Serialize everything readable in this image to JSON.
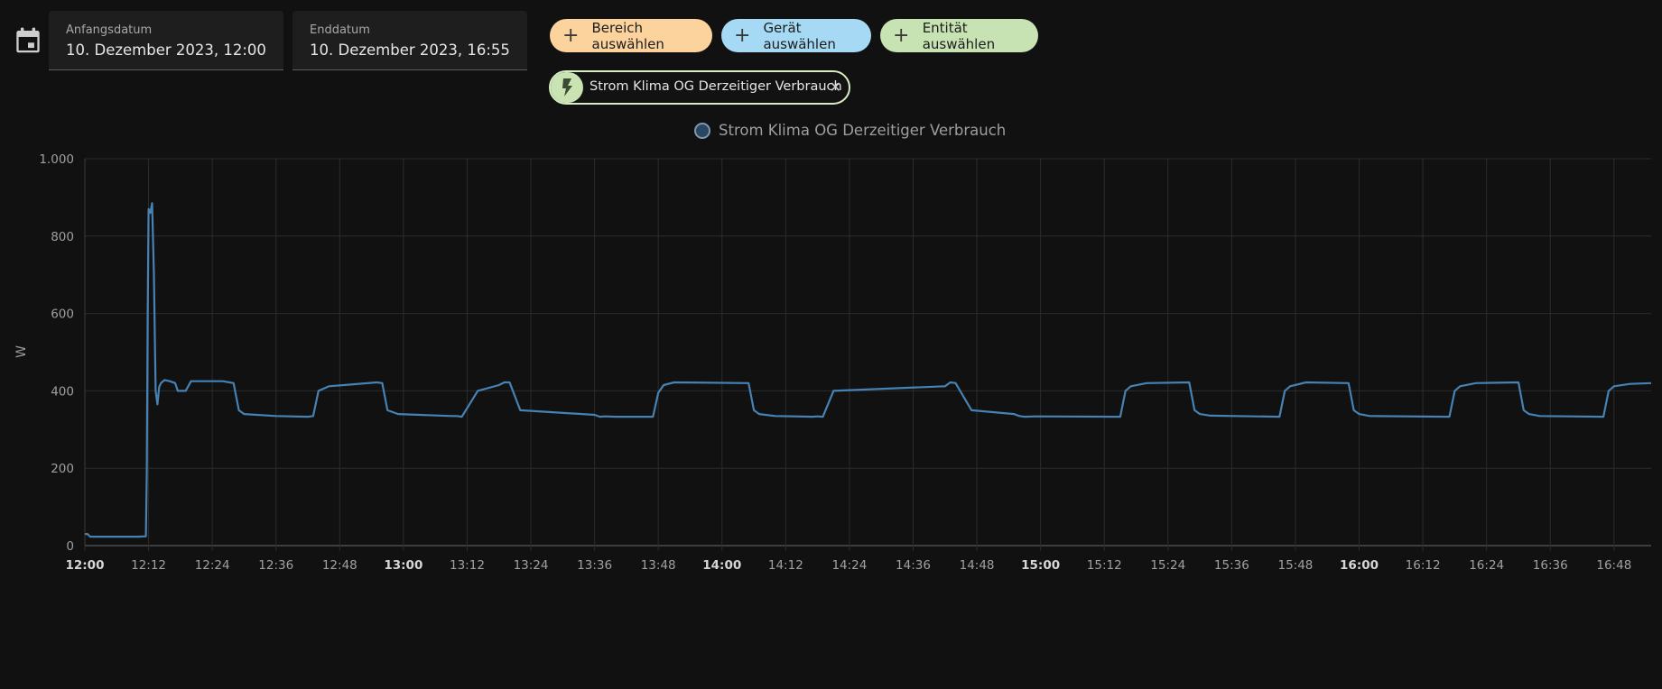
{
  "date_range": {
    "start_label": "Anfangsdatum",
    "start_value": "10. Dezember 2023, 12:00",
    "end_label": "Enddatum",
    "end_value": "10. Dezember 2023, 16:55"
  },
  "target_picker": {
    "area_label": "Bereich auswählen",
    "device_label": "Gerät auswählen",
    "entity_label": "Entität auswählen",
    "area_color": "#fdd39d",
    "device_color": "#a6d9f3",
    "entity_color": "#c8e3b3"
  },
  "selected_entity": {
    "name": "Strom Klima OG Derzeitiger Verbrauch",
    "icon": "flash-icon",
    "remove_icon": "close-icon"
  },
  "chart_data": {
    "type": "line",
    "ylabel": "W",
    "ylim": [
      0,
      1000
    ],
    "yticks": [
      0,
      200,
      400,
      600,
      800,
      1000
    ],
    "ytick_labels": [
      "0",
      "200",
      "400",
      "600",
      "800",
      "1.000"
    ],
    "xlim": [
      "12:00",
      "16:55"
    ],
    "xtick_labels": [
      "12:00",
      "12:12",
      "12:24",
      "12:36",
      "12:48",
      "13:00",
      "13:12",
      "13:24",
      "13:36",
      "13:48",
      "14:00",
      "14:12",
      "14:24",
      "14:36",
      "14:48",
      "15:00",
      "15:12",
      "15:24",
      "15:36",
      "15:48",
      "16:00",
      "16:12",
      "16:24",
      "16:36",
      "16:48"
    ],
    "xtick_bold": [
      "12:00",
      "13:00",
      "14:00",
      "15:00",
      "16:00"
    ],
    "grid": true,
    "legend_position": "top-center",
    "line_color": "#4682b4",
    "series": [
      {
        "name": "Strom Klima OG Derzeitiger Verbrauch",
        "x": [
          "12:00",
          "12:00:30",
          "12:01",
          "12:05",
          "12:10",
          "12:11:30",
          "12:11:40",
          "12:11:50",
          "12:12:00",
          "12:12:20",
          "12:12:40",
          "12:13",
          "12:13:20",
          "12:13:40",
          "12:14",
          "12:14:20",
          "12:15",
          "12:16",
          "12:17",
          "12:17:30",
          "12:18",
          "12:19",
          "12:20",
          "12:26",
          "12:28",
          "12:29",
          "12:30",
          "12:36",
          "12:42",
          "12:43",
          "12:44",
          "12:46",
          "12:55",
          "12:56",
          "12:57",
          "12:59",
          "13:09",
          "13:10",
          "13:11",
          "13:14",
          "13:18",
          "13:19",
          "13:20",
          "13:22",
          "13:36",
          "13:37",
          "13:38",
          "13:40",
          "13:47",
          "13:48",
          "13:49",
          "13:51",
          "14:05",
          "14:06",
          "14:07",
          "14:10",
          "14:17",
          "14:18",
          "14:19",
          "14:21",
          "14:42",
          "14:43",
          "14:44",
          "14:47",
          "14:55",
          "14:56",
          "14:57",
          "14:59",
          "15:15",
          "15:16",
          "15:17",
          "15:20",
          "15:28",
          "15:29",
          "15:30",
          "15:32",
          "15:45",
          "15:46",
          "15:47",
          "15:50",
          "15:58",
          "15:59",
          "16:00",
          "16:02",
          "16:17",
          "16:18",
          "16:19",
          "16:22",
          "16:30",
          "16:31",
          "16:32",
          "16:34",
          "16:46",
          "16:47",
          "16:48",
          "16:51",
          "16:55"
        ],
        "y": [
          30,
          30,
          23,
          23,
          23,
          24,
          190,
          600,
          870,
          860,
          885,
          700,
          400,
          365,
          410,
          420,
          428,
          425,
          420,
          400,
          400,
          400,
          425,
          425,
          420,
          350,
          340,
          335,
          333,
          335,
          400,
          412,
          422,
          420,
          350,
          340,
          335,
          335,
          333,
          400,
          415,
          422,
          422,
          350,
          338,
          333,
          334,
          333,
          333,
          395,
          415,
          422,
          420,
          350,
          340,
          335,
          333,
          334,
          333,
          400,
          412,
          422,
          420,
          350,
          340,
          335,
          333,
          334,
          333,
          400,
          412,
          420,
          422,
          350,
          340,
          336,
          333,
          400,
          412,
          422,
          420,
          350,
          340,
          335,
          333,
          400,
          412,
          420,
          422,
          350,
          340,
          335,
          333,
          400,
          412,
          418,
          420
        ]
      }
    ]
  }
}
